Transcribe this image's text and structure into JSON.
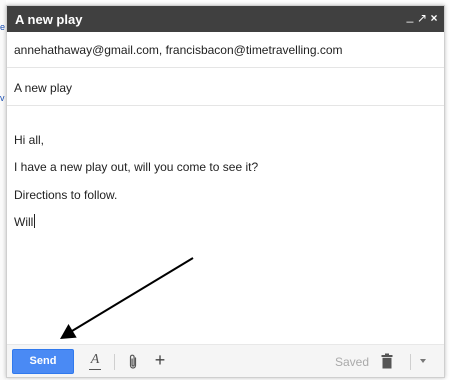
{
  "window": {
    "title": "A new play",
    "minimize_glyph": "_",
    "popout_glyph": "↗",
    "close_glyph": "×"
  },
  "background": {
    "fragments": [
      "e",
      "v"
    ]
  },
  "compose": {
    "recipients": "annehathaway@gmail.com, francisbacon@timetravelling.com",
    "subject": "A new play",
    "body_lines": [
      "Hi all,",
      "I have a new play out, will you come to see it?",
      "Directions to follow.",
      "Will"
    ]
  },
  "toolbar": {
    "send_label": "Send",
    "format_glyph": "A",
    "attach_icon": "paperclip-icon",
    "more_glyph": "+",
    "saved_label": "Saved",
    "trash_icon": "trash-icon",
    "options_icon": "chevron-down-icon"
  },
  "colors": {
    "titlebar": "#404040",
    "send_button": "#4a8af4",
    "annotation_arrow": "#000000"
  }
}
